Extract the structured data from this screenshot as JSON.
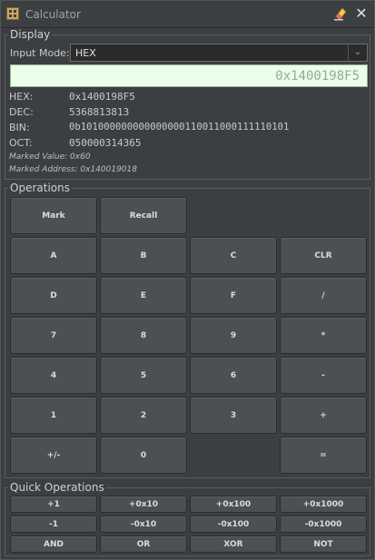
{
  "window": {
    "title": "Calculator"
  },
  "display_section": {
    "legend": "Display",
    "input_mode_label": "Input Mode:",
    "input_mode_value": "HEX",
    "display_value": "0x1400198F5",
    "rows": [
      {
        "label": "HEX:",
        "value": "0x1400198F5"
      },
      {
        "label": "DEC:",
        "value": "5368813813"
      },
      {
        "label": "BIN:",
        "value": "0b101000000000000000110011000111110101"
      },
      {
        "label": "OCT:",
        "value": "050000314365"
      }
    ],
    "marked_value": "Marked Value: 0x60",
    "marked_address": "Marked Address: 0x140019018"
  },
  "operations": {
    "legend": "Operations",
    "mark": "Mark",
    "recall": "Recall",
    "keys": [
      "A",
      "B",
      "C",
      "CLR",
      "D",
      "E",
      "F",
      "/",
      "7",
      "8",
      "9",
      "*",
      "4",
      "5",
      "6",
      "-",
      "1",
      "2",
      "3",
      "+",
      "+/-",
      "0",
      "="
    ]
  },
  "quick": {
    "legend": "Quick Operations",
    "keys": [
      "+1",
      "+0x10",
      "+0x100",
      "+0x1000",
      "-1",
      "-0x10",
      "-0x100",
      "-0x1000",
      "AND",
      "OR",
      "XOR",
      "NOT"
    ]
  }
}
